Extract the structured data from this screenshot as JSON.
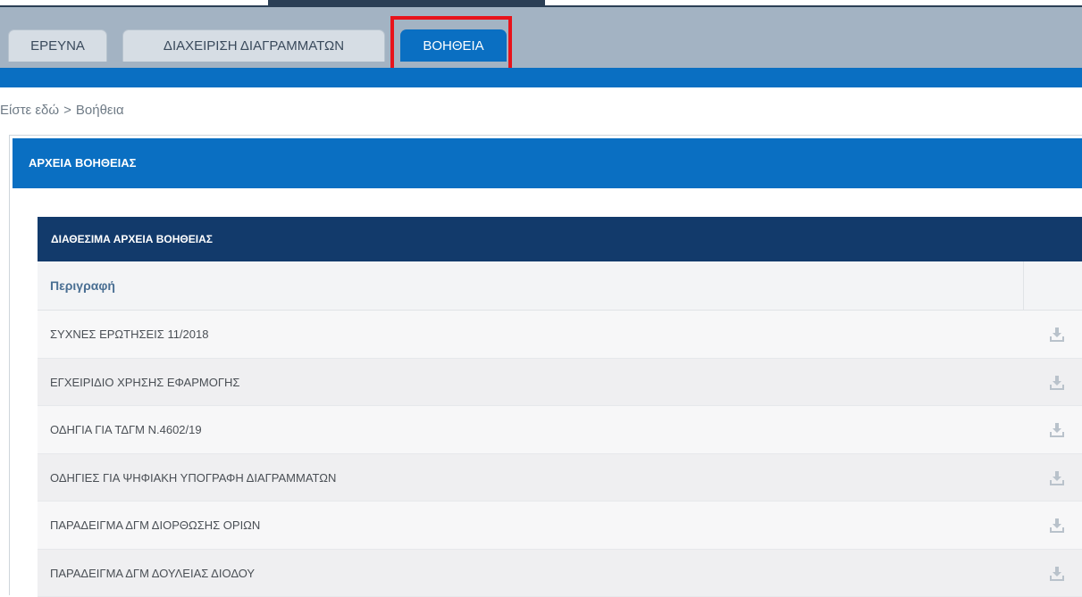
{
  "tabs": [
    {
      "label": "ΕΡΕΥΝΑ",
      "active": false
    },
    {
      "label": "ΔΙΑΧΕΙΡΙΣΗ ΔΙΑΓΡΑΜΜΑΤΩΝ",
      "active": false
    },
    {
      "label": "ΒΟΗΘΕΙΑ",
      "active": true
    }
  ],
  "breadcrumb": {
    "prefix": "Είστε εδώ",
    "separator": ">",
    "current": "Βοήθεια"
  },
  "panel": {
    "title": "ΑΡΧΕΙΑ ΒΟΗΘΕΙΑΣ"
  },
  "table": {
    "title": "ΔΙΑΘΕΣΙΜΑ ΑΡΧΕΙΑ ΒΟΗΘΕΙΑΣ",
    "column_description": "Περιγραφή",
    "rows": [
      {
        "description": "ΣΥΧΝΕΣ ΕΡΩΤΗΣΕΙΣ 11/2018",
        "action_icon": "download-icon"
      },
      {
        "description": "ΕΓΧΕΙΡΙΔΙΟ ΧΡΗΣΗΣ ΕΦΑΡΜΟΓΗΣ",
        "action_icon": "download-icon"
      },
      {
        "description": "ΟΔΗΓΙΑ ΓΙΑ ΤΔΓΜ Ν.4602/19",
        "action_icon": "download-icon"
      },
      {
        "description": "ΟΔΗΓΙΕΣ ΓΙΑ ΨΗΦΙΑΚΗ ΥΠΟΓΡΑΦΗ ΔΙΑΓΡΑΜΜΑΤΩΝ",
        "action_icon": "download-icon"
      },
      {
        "description": "ΠΑΡΑΔΕΙΓΜΑ ΔΓΜ ΔΙΟΡΘΩΣΗΣ ΟΡΙΩΝ",
        "action_icon": "download-icon"
      },
      {
        "description": "ΠΑΡΑΔΕΙΓΜΑ ΔΓΜ ΔΟΥΛΕΙΑΣ ΔΙΟΔΟΥ",
        "action_icon": "download-icon"
      }
    ]
  },
  "colors": {
    "primary_blue": "#0a6fc2",
    "table_header_navy": "#123a6b",
    "tab_bar_gray": "#a3b3c3",
    "highlight_red": "#e8131b"
  }
}
